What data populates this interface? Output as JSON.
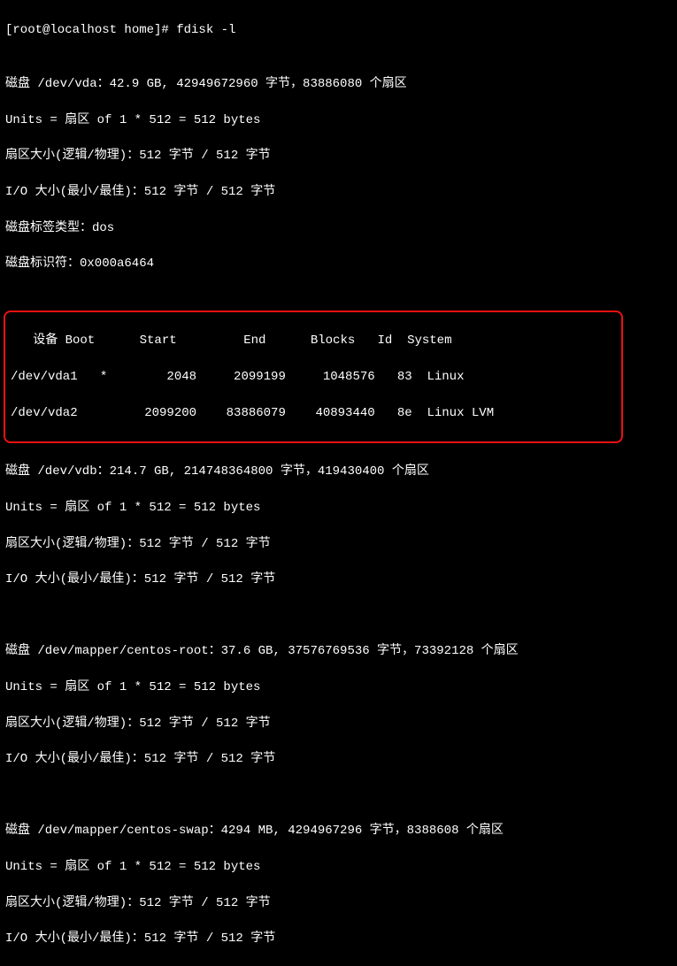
{
  "prompt": "[root@localhost home]# fdisk -l",
  "blank": "",
  "disk_vda": {
    "header": "磁盘 /dev/vda：42.9 GB, 42949672960 字节，83886080 个扇区",
    "units": "Units = 扇区 of 1 * 512 = 512 bytes",
    "sector_lp": "扇区大小(逻辑/物理)：512 字节 / 512 字节",
    "io": "I/O 大小(最小/最佳)：512 字节 / 512 字节",
    "label_type": "磁盘标签类型：dos",
    "identifier": "磁盘标识符：0x000a6464"
  },
  "partition_table": {
    "header": "   设备 Boot      Start         End      Blocks   Id  System",
    "row1": "/dev/vda1   *        2048     2099199     1048576   83  Linux",
    "row2": "/dev/vda2         2099200    83886079    40893440   8e  Linux LVM"
  },
  "disk_vdb": {
    "header": "磁盘 /dev/vdb：214.7 GB, 214748364800 字节，419430400 个扇区",
    "units": "Units = 扇区 of 1 * 512 = 512 bytes",
    "sector_lp": "扇区大小(逻辑/物理)：512 字节 / 512 字节",
    "io": "I/O 大小(最小/最佳)：512 字节 / 512 字节"
  },
  "mapper_root": {
    "header": "磁盘 /dev/mapper/centos-root：37.6 GB, 37576769536 字节，73392128 个扇区",
    "units": "Units = 扇区 of 1 * 512 = 512 bytes",
    "sector_lp": "扇区大小(逻辑/物理)：512 字节 / 512 字节",
    "io": "I/O 大小(最小/最佳)：512 字节 / 512 字节"
  },
  "mapper_swap": {
    "header": "磁盘 /dev/mapper/centos-swap：4294 MB, 4294967296 字节，8388608 个扇区",
    "units": "Units = 扇区 of 1 * 512 = 512 bytes",
    "sector_lp": "扇区大小(逻辑/物理)：512 字节 / 512 字节",
    "io": "I/O 大小(最小/最佳)：512 字节 / 512 字节"
  }
}
